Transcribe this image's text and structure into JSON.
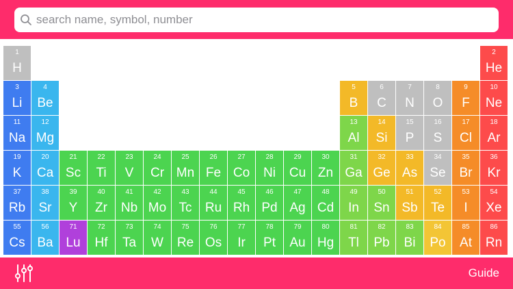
{
  "search": {
    "placeholder": "search name, symbol, number"
  },
  "toolbar": {
    "guide_label": "Guide"
  },
  "icons": {
    "search": "search-icon",
    "filter": "sliders-icon"
  },
  "colors": {
    "brand": "#fe2c6b",
    "nonmetal": "#bfbfbf",
    "noble_gas": "#fd4b4b",
    "alkali": "#3f7cf0",
    "alkaline_earth": "#3ab6ee",
    "transition": "#4cd450",
    "post_transition": "#7ed64a",
    "metalloid": "#f3b928",
    "halogen": "#f58c28",
    "lanthanide": "#b040db",
    "polonium": "#f3c535",
    "astatine": "#f58c28"
  },
  "elements": [
    {
      "n": "1",
      "s": "H",
      "c": "nonmetal",
      "col": 1,
      "row": 1
    },
    {
      "n": "2",
      "s": "He",
      "c": "noble_gas",
      "col": 18,
      "row": 1
    },
    {
      "n": "3",
      "s": "Li",
      "c": "alkali",
      "col": 1,
      "row": 2
    },
    {
      "n": "4",
      "s": "Be",
      "c": "alkaline_earth",
      "col": 2,
      "row": 2
    },
    {
      "n": "5",
      "s": "B",
      "c": "metalloid",
      "col": 13,
      "row": 2
    },
    {
      "n": "6",
      "s": "C",
      "c": "nonmetal",
      "col": 14,
      "row": 2
    },
    {
      "n": "7",
      "s": "N",
      "c": "nonmetal",
      "col": 15,
      "row": 2
    },
    {
      "n": "8",
      "s": "O",
      "c": "nonmetal",
      "col": 16,
      "row": 2
    },
    {
      "n": "9",
      "s": "F",
      "c": "halogen",
      "col": 17,
      "row": 2
    },
    {
      "n": "10",
      "s": "Ne",
      "c": "noble_gas",
      "col": 18,
      "row": 2
    },
    {
      "n": "11",
      "s": "Na",
      "c": "alkali",
      "col": 1,
      "row": 3
    },
    {
      "n": "12",
      "s": "Mg",
      "c": "alkaline_earth",
      "col": 2,
      "row": 3
    },
    {
      "n": "13",
      "s": "Al",
      "c": "post_transition",
      "col": 13,
      "row": 3
    },
    {
      "n": "14",
      "s": "Si",
      "c": "metalloid",
      "col": 14,
      "row": 3
    },
    {
      "n": "15",
      "s": "P",
      "c": "nonmetal",
      "col": 15,
      "row": 3
    },
    {
      "n": "16",
      "s": "S",
      "c": "nonmetal",
      "col": 16,
      "row": 3
    },
    {
      "n": "17",
      "s": "Cl",
      "c": "halogen",
      "col": 17,
      "row": 3
    },
    {
      "n": "18",
      "s": "Ar",
      "c": "noble_gas",
      "col": 18,
      "row": 3
    },
    {
      "n": "19",
      "s": "K",
      "c": "alkali",
      "col": 1,
      "row": 4
    },
    {
      "n": "20",
      "s": "Ca",
      "c": "alkaline_earth",
      "col": 2,
      "row": 4
    },
    {
      "n": "21",
      "s": "Sc",
      "c": "transition",
      "col": 3,
      "row": 4
    },
    {
      "n": "22",
      "s": "Ti",
      "c": "transition",
      "col": 4,
      "row": 4
    },
    {
      "n": "23",
      "s": "V",
      "c": "transition",
      "col": 5,
      "row": 4
    },
    {
      "n": "24",
      "s": "Cr",
      "c": "transition",
      "col": 6,
      "row": 4
    },
    {
      "n": "25",
      "s": "Mn",
      "c": "transition",
      "col": 7,
      "row": 4
    },
    {
      "n": "26",
      "s": "Fe",
      "c": "transition",
      "col": 8,
      "row": 4
    },
    {
      "n": "27",
      "s": "Co",
      "c": "transition",
      "col": 9,
      "row": 4
    },
    {
      "n": "28",
      "s": "Ni",
      "c": "transition",
      "col": 10,
      "row": 4
    },
    {
      "n": "29",
      "s": "Cu",
      "c": "transition",
      "col": 11,
      "row": 4
    },
    {
      "n": "30",
      "s": "Zn",
      "c": "transition",
      "col": 12,
      "row": 4
    },
    {
      "n": "31",
      "s": "Ga",
      "c": "post_transition",
      "col": 13,
      "row": 4
    },
    {
      "n": "32",
      "s": "Ge",
      "c": "metalloid",
      "col": 14,
      "row": 4
    },
    {
      "n": "33",
      "s": "As",
      "c": "metalloid",
      "col": 15,
      "row": 4
    },
    {
      "n": "34",
      "s": "Se",
      "c": "nonmetal",
      "col": 16,
      "row": 4
    },
    {
      "n": "35",
      "s": "Br",
      "c": "halogen",
      "col": 17,
      "row": 4
    },
    {
      "n": "36",
      "s": "Kr",
      "c": "noble_gas",
      "col": 18,
      "row": 4
    },
    {
      "n": "37",
      "s": "Rb",
      "c": "alkali",
      "col": 1,
      "row": 5
    },
    {
      "n": "38",
      "s": "Sr",
      "c": "alkaline_earth",
      "col": 2,
      "row": 5
    },
    {
      "n": "39",
      "s": "Y",
      "c": "transition",
      "col": 3,
      "row": 5
    },
    {
      "n": "40",
      "s": "Zr",
      "c": "transition",
      "col": 4,
      "row": 5
    },
    {
      "n": "41",
      "s": "Nb",
      "c": "transition",
      "col": 5,
      "row": 5
    },
    {
      "n": "42",
      "s": "Mo",
      "c": "transition",
      "col": 6,
      "row": 5
    },
    {
      "n": "43",
      "s": "Tc",
      "c": "transition",
      "col": 7,
      "row": 5
    },
    {
      "n": "44",
      "s": "Ru",
      "c": "transition",
      "col": 8,
      "row": 5
    },
    {
      "n": "45",
      "s": "Rh",
      "c": "transition",
      "col": 9,
      "row": 5
    },
    {
      "n": "46",
      "s": "Pd",
      "c": "transition",
      "col": 10,
      "row": 5
    },
    {
      "n": "47",
      "s": "Ag",
      "c": "transition",
      "col": 11,
      "row": 5
    },
    {
      "n": "48",
      "s": "Cd",
      "c": "transition",
      "col": 12,
      "row": 5
    },
    {
      "n": "49",
      "s": "In",
      "c": "post_transition",
      "col": 13,
      "row": 5
    },
    {
      "n": "50",
      "s": "Sn",
      "c": "post_transition",
      "col": 14,
      "row": 5
    },
    {
      "n": "51",
      "s": "Sb",
      "c": "metalloid",
      "col": 15,
      "row": 5
    },
    {
      "n": "52",
      "s": "Te",
      "c": "metalloid",
      "col": 16,
      "row": 5
    },
    {
      "n": "53",
      "s": "I",
      "c": "halogen",
      "col": 17,
      "row": 5
    },
    {
      "n": "54",
      "s": "Xe",
      "c": "noble_gas",
      "col": 18,
      "row": 5
    },
    {
      "n": "55",
      "s": "Cs",
      "c": "alkali",
      "col": 1,
      "row": 6
    },
    {
      "n": "56",
      "s": "Ba",
      "c": "alkaline_earth",
      "col": 2,
      "row": 6
    },
    {
      "n": "71",
      "s": "Lu",
      "c": "lanthanide",
      "col": 3,
      "row": 6
    },
    {
      "n": "72",
      "s": "Hf",
      "c": "transition",
      "col": 4,
      "row": 6
    },
    {
      "n": "73",
      "s": "Ta",
      "c": "transition",
      "col": 5,
      "row": 6
    },
    {
      "n": "74",
      "s": "W",
      "c": "transition",
      "col": 6,
      "row": 6
    },
    {
      "n": "75",
      "s": "Re",
      "c": "transition",
      "col": 7,
      "row": 6
    },
    {
      "n": "76",
      "s": "Os",
      "c": "transition",
      "col": 8,
      "row": 6
    },
    {
      "n": "77",
      "s": "Ir",
      "c": "transition",
      "col": 9,
      "row": 6
    },
    {
      "n": "78",
      "s": "Pt",
      "c": "transition",
      "col": 10,
      "row": 6
    },
    {
      "n": "79",
      "s": "Au",
      "c": "transition",
      "col": 11,
      "row": 6
    },
    {
      "n": "80",
      "s": "Hg",
      "c": "transition",
      "col": 12,
      "row": 6
    },
    {
      "n": "81",
      "s": "Tl",
      "c": "post_transition",
      "col": 13,
      "row": 6
    },
    {
      "n": "82",
      "s": "Pb",
      "c": "post_transition",
      "col": 14,
      "row": 6
    },
    {
      "n": "83",
      "s": "Bi",
      "c": "post_transition",
      "col": 15,
      "row": 6
    },
    {
      "n": "84",
      "s": "Po",
      "c": "polonium",
      "col": 16,
      "row": 6
    },
    {
      "n": "85",
      "s": "At",
      "c": "astatine",
      "col": 17,
      "row": 6
    },
    {
      "n": "86",
      "s": "Rn",
      "c": "noble_gas",
      "col": 18,
      "row": 6
    }
  ]
}
